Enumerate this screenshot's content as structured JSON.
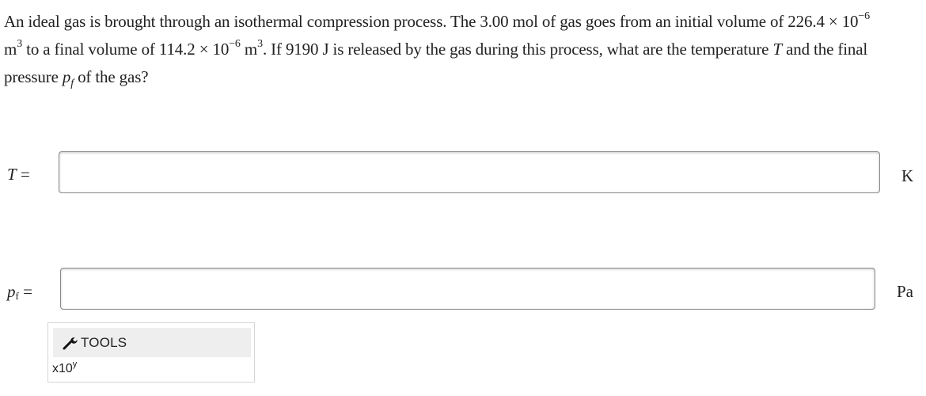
{
  "question": {
    "part1": "An ideal gas is brought through an isothermal compression process. The 3.00 mol of gas goes from an initial volume of 226.4 × 10",
    "exp1": "−6",
    "part2": " m",
    "cube1": "3",
    "part3": " to a final volume of 114.2 × 10",
    "exp2": "−6",
    "part4": " m",
    "cube2": "3",
    "part5": ". If 9190 J is released by the gas during this process, what are the temperature ",
    "var_t": "T",
    "part6": " and the final pressure ",
    "var_p": "p",
    "var_p_sub": "f",
    "part7": " of the gas?"
  },
  "answers": {
    "temperature": {
      "label_var": "T",
      "label_eq": " =",
      "value": "",
      "unit": "K"
    },
    "pressure": {
      "label_var": "p",
      "label_sub": "f",
      "label_eq": " =",
      "value": "",
      "unit": "Pa"
    }
  },
  "tools": {
    "label": "TOOLS",
    "icon": "wrench-icon",
    "x10_base": "x10",
    "x10_exp": "y"
  }
}
